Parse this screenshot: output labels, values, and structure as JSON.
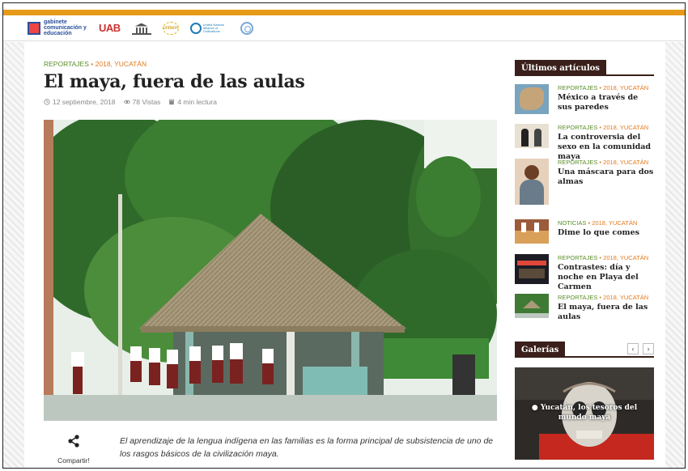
{
  "header": {
    "logo_gabinete": "gabinete comunicación y educación",
    "logo_uab": "UAB",
    "logo_unitwin": "unitwin",
    "logo_un_text": "United Nations Alliance of Civilizations"
  },
  "article": {
    "cat1": "REPORTAJES",
    "sep": "•",
    "cat2": "2018, YUCATÁN",
    "title": "El maya, fuera de las aulas",
    "date": "12 septiembre, 2018",
    "views": "78 Vistas",
    "read": "4 min lectura",
    "share_label": "Compartir!",
    "excerpt": "El aprendizaje de la lengua indígena en las familias es la forma principal de subsistencia de uno de los rasgos básicos de la civilización maya."
  },
  "sidebar": {
    "heading": "Últimos artículos",
    "items": [
      {
        "cat1": "REPORTAJES",
        "cat2": "2018, YUCATÁN",
        "title": "México a través de sus paredes"
      },
      {
        "cat1": "REPORTAJES",
        "cat2": "2018, YUCATÁN",
        "title": "La controversia del sexo en la comunidad maya"
      },
      {
        "cat1": "REPORTAJES",
        "cat2": "2018, YUCATÁN",
        "title": "Una máscara para dos almas"
      },
      {
        "cat1": "NOTICIAS",
        "cat2": "2018, YUCATÁN",
        "title": "Dime lo que comes"
      },
      {
        "cat1": "REPORTAJES",
        "cat2": "2018, YUCATÁN",
        "title": "Contrastes: día y noche en Playa del Carmen"
      },
      {
        "cat1": "REPORTAJES",
        "cat2": "2018, YUCATÁN",
        "title": "El maya, fuera de las aulas"
      }
    ],
    "gallery_heading": "Galerías",
    "gallery_prev": "‹",
    "gallery_next": "›",
    "gallery_caption": "Yucatán, los tesoros del mundo maya"
  },
  "colors": {
    "accent_orange": "#e69a18",
    "category_green": "#5a8f2a",
    "category_orange": "#e07a20",
    "heading_dark": "#3a1f1a"
  }
}
